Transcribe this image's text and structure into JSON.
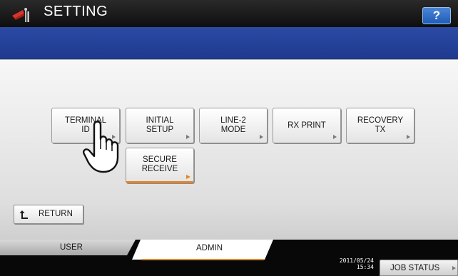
{
  "header": {
    "title": "SETTING",
    "help_label": "?",
    "app_icon": "setting-tools-icon"
  },
  "menu": {
    "buttons": [
      {
        "label": "TERMINAL\nID"
      },
      {
        "label": "INITIAL\nSETUP"
      },
      {
        "label": "LINE-2\nMODE"
      },
      {
        "label": "RX PRINT"
      },
      {
        "label": "RECOVERY\nTX"
      },
      {
        "label": "SECURE\nRECEIVE"
      }
    ]
  },
  "pointer": {
    "icon": "hand-pointer-icon"
  },
  "return": {
    "label": "RETURN",
    "icon": "return-arrow-icon"
  },
  "tabs": {
    "user": "USER",
    "admin": "ADMIN",
    "active": "ADMIN"
  },
  "status": {
    "date": "2011/05/24",
    "time": "15:34",
    "job_status_label": "JOB STATUS"
  },
  "colors": {
    "blue_bar": "#1e3a8f",
    "accent_orange": "#e2852a",
    "help_blue": "#1e5db8"
  }
}
